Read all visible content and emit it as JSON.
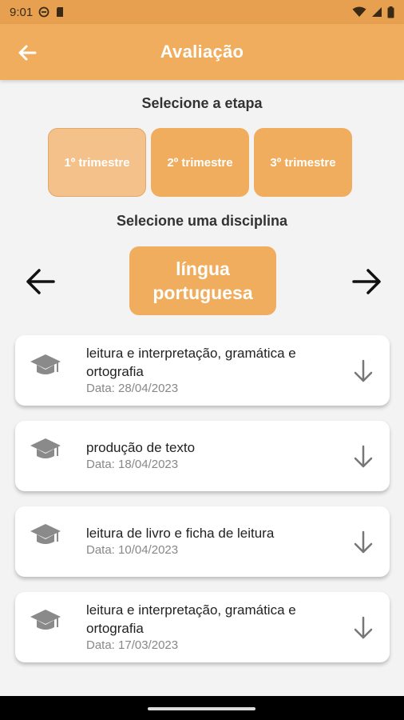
{
  "status_bar": {
    "time": "9:01"
  },
  "app_bar": {
    "title": "Avaliação"
  },
  "stage_section": {
    "label": "Selecione a etapa",
    "options": [
      "1º trimestre",
      "2º trimestre",
      "3º trimestre"
    ],
    "selected_index": 0
  },
  "discipline_section": {
    "label": "Selecione uma disciplina",
    "current": "língua portuguesa"
  },
  "evaluations": [
    {
      "title": "leitura e interpretação, gramática e ortografia",
      "date": "Data: 28/04/2023"
    },
    {
      "title": "produção de texto",
      "date": "Data: 18/04/2023"
    },
    {
      "title": "leitura de livro e ficha de leitura",
      "date": "Data: 10/04/2023"
    },
    {
      "title": "leitura e interpretação, gramática e ortografia",
      "date": "Data: 17/03/2023"
    }
  ],
  "colors": {
    "accent": "#f0ad5d",
    "accent_selected": "#f3c189",
    "status_bar": "#e6a04f",
    "background": "#f3f3f3"
  },
  "icons": {
    "back": "arrow-left-icon",
    "prev": "arrow-left-icon",
    "next": "arrow-right-icon",
    "card": "graduation-cap-icon",
    "download": "arrow-down-icon"
  }
}
